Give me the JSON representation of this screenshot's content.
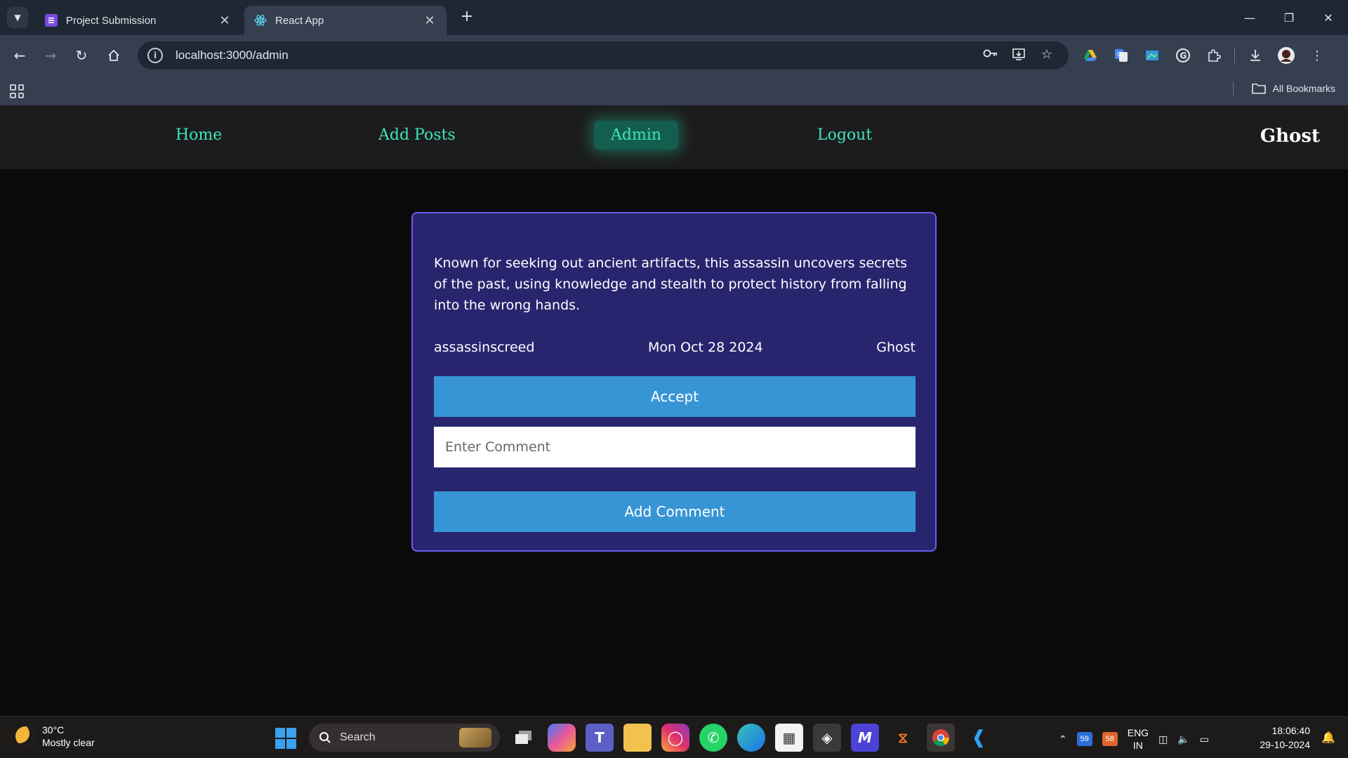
{
  "browser": {
    "tabs": [
      {
        "label": "Project Submission",
        "active": false
      },
      {
        "label": "React App",
        "active": true
      }
    ],
    "url": "localhost:3000/admin",
    "bookmarks_label": "All Bookmarks"
  },
  "nav": {
    "items": [
      {
        "label": "Home"
      },
      {
        "label": "Add Posts"
      },
      {
        "label": "Admin"
      },
      {
        "label": "Logout"
      }
    ],
    "brand": "Ghost"
  },
  "post": {
    "description": "Known for seeking out ancient artifacts, this assassin uncovers secrets of the past, using knowledge and stealth to protect history from falling into the wrong hands.",
    "tag": "assassinscreed",
    "date": "Mon Oct 28 2024",
    "author": "Ghost",
    "accept_label": "Accept",
    "comment_placeholder": "Enter Comment",
    "add_comment_label": "Add Comment"
  },
  "taskbar": {
    "weather_temp": "30°C",
    "weather_desc": "Mostly clear",
    "search_label": "Search",
    "badge1": "59",
    "badge2": "58",
    "lang1": "ENG",
    "lang2": "IN",
    "time": "18:06:40",
    "date": "29-10-2024"
  },
  "colors": {
    "nav_link": "#3ee4bd",
    "card_bg": "#28256e",
    "card_border": "#6c5cf0",
    "button": "#3795d6"
  }
}
